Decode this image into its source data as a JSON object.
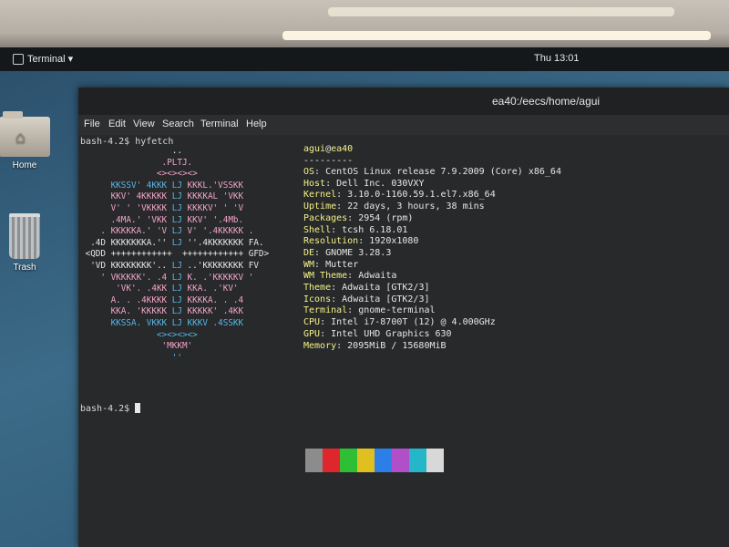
{
  "topbar": {
    "app_menu": "Terminal ▾",
    "clock": "Thu 13:01"
  },
  "desktop": {
    "home_label": "Home",
    "trash_label": "Trash"
  },
  "terminal": {
    "title": "ea40:/eecs/home/agui",
    "menu": [
      "File",
      "Edit",
      "View",
      "Search",
      "Terminal",
      "Help"
    ],
    "prompt1": "bash-4.2$ hyfetch",
    "prompt2": "bash-4.2$ ",
    "user": "agui",
    "at": "@",
    "host_name": "ea40",
    "separator": "---------",
    "info": [
      {
        "key": "OS",
        "value": "CentOS Linux release 7.9.2009 (Core) x86_64"
      },
      {
        "key": "Host",
        "value": "Dell Inc. 030VXY"
      },
      {
        "key": "Kernel",
        "value": "3.10.0-1160.59.1.el7.x86_64"
      },
      {
        "key": "Uptime",
        "value": "22 days, 3 hours, 38 mins"
      },
      {
        "key": "Packages",
        "value": "2954 (rpm)"
      },
      {
        "key": "Shell",
        "value": "tcsh 6.18.01"
      },
      {
        "key": "Resolution",
        "value": "1920x1080"
      },
      {
        "key": "DE",
        "value": "GNOME 3.28.3"
      },
      {
        "key": "WM",
        "value": "Mutter"
      },
      {
        "key": "WM Theme",
        "value": "Adwaita"
      },
      {
        "key": "Theme",
        "value": "Adwaita [GTK2/3]"
      },
      {
        "key": "Icons",
        "value": "Adwaita [GTK2/3]"
      },
      {
        "key": "Terminal",
        "value": "gnome-terminal"
      },
      {
        "key": "CPU",
        "value": "Intel i7-8700T (12) @ 4.000GHz"
      },
      {
        "key": "GPU",
        "value": "Intel UHD Graphics 630"
      },
      {
        "key": "Memory",
        "value": "2095MiB / 15680MiB"
      }
    ],
    "logo": [
      [
        {
          "t": "                  ..",
          "c": "w"
        }
      ],
      [
        {
          "t": "                .PLTJ.",
          "c": "p"
        }
      ],
      [
        {
          "t": "               <><><><>",
          "c": "p"
        }
      ],
      [
        {
          "t": "      KKSSV' 4KKK ",
          "c": "b"
        },
        {
          "t": "LJ",
          "c": "b"
        },
        {
          "t": " KKKL.'VSSKK",
          "c": "p"
        }
      ],
      [
        {
          "t": "      KKV' 4KKKKK ",
          "c": "p"
        },
        {
          "t": "LJ",
          "c": "b"
        },
        {
          "t": " KKKKAL 'VKK",
          "c": "p"
        }
      ],
      [
        {
          "t": "      V' ' 'VKKKK ",
          "c": "p"
        },
        {
          "t": "LJ",
          "c": "b"
        },
        {
          "t": " KKKKV' ' 'V",
          "c": "p"
        }
      ],
      [
        {
          "t": "      .4MA.' 'VKK ",
          "c": "p"
        },
        {
          "t": "LJ",
          "c": "b"
        },
        {
          "t": " KKV' '.4Mb.",
          "c": "p"
        }
      ],
      [
        {
          "t": "    . KKKKKA.' 'V ",
          "c": "p"
        },
        {
          "t": "LJ",
          "c": "b"
        },
        {
          "t": " V' '.4KKKKK .",
          "c": "p"
        }
      ],
      [
        {
          "t": "  .4D KKKKKKKA.'' ",
          "c": "w"
        },
        {
          "t": "LJ",
          "c": "b"
        },
        {
          "t": " ''.4KKKKKKK FA.",
          "c": "w"
        }
      ],
      [
        {
          "t": " <QDD ++++++++++++  ",
          "c": "w"
        },
        {
          "t": "++++++++++++ GFD>",
          "c": "w"
        }
      ],
      [
        {
          "t": "  'VD KKKKKKKK'.. ",
          "c": "w"
        },
        {
          "t": "LJ",
          "c": "b"
        },
        {
          "t": " ..'KKKKKKKK FV",
          "c": "w"
        }
      ],
      [
        {
          "t": "    ' VKKKKK'. .4 ",
          "c": "p"
        },
        {
          "t": "LJ",
          "c": "b"
        },
        {
          "t": " K. .'KKKKKV '",
          "c": "p"
        }
      ],
      [
        {
          "t": "       'VK'. .4KK ",
          "c": "p"
        },
        {
          "t": "LJ",
          "c": "b"
        },
        {
          "t": " KKA. .'KV'",
          "c": "p"
        }
      ],
      [
        {
          "t": "      A. . .4KKKK ",
          "c": "p"
        },
        {
          "t": "LJ",
          "c": "b"
        },
        {
          "t": " KKKKA. . .4",
          "c": "p"
        }
      ],
      [
        {
          "t": "      KKA. 'KKKKK ",
          "c": "p"
        },
        {
          "t": "LJ",
          "c": "b"
        },
        {
          "t": " KKKKK' .4KK",
          "c": "p"
        }
      ],
      [
        {
          "t": "      KKSSA. VKKK ",
          "c": "b"
        },
        {
          "t": "LJ",
          "c": "b"
        },
        {
          "t": " KKKV .4SSKK",
          "c": "b"
        }
      ],
      [
        {
          "t": "               <><><><>",
          "c": "b"
        }
      ],
      [
        {
          "t": "                'MKKM'",
          "c": "p"
        }
      ],
      [
        {
          "t": "                  ''",
          "c": "b"
        }
      ]
    ],
    "swatches": [
      "#8c8c8c",
      "#e0262d",
      "#2fbf34",
      "#e0c020",
      "#2d7fe8",
      "#b04fc8",
      "#25b7c8",
      "#d8d8d8"
    ]
  }
}
